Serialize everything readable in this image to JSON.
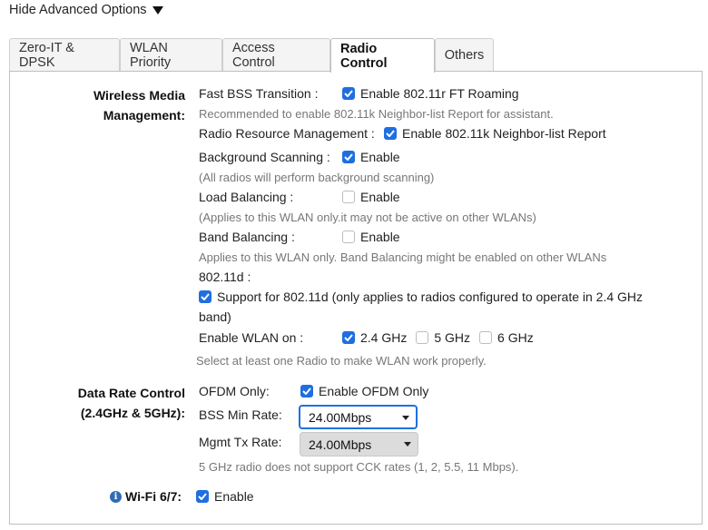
{
  "advanced_toggle": {
    "label": "Hide Advanced Options"
  },
  "tabs": [
    {
      "label": "Zero-IT & DPSK"
    },
    {
      "label": "WLAN Priority"
    },
    {
      "label": "Access Control"
    },
    {
      "label": "Radio Control",
      "active": true
    },
    {
      "label": "Others"
    }
  ],
  "wireless_media": {
    "label_line1": "Wireless Media",
    "label_line2": "Management:",
    "fast_bss": {
      "label": "Fast BSS Transition :",
      "checkbox_label": "Enable 802.11r FT Roaming",
      "checked": true,
      "hint": "Recommended to enable 802.11k Neighbor-list Report for assistant."
    },
    "rrm": {
      "label": "Radio Resource Management :",
      "checkbox_label": "Enable 802.11k Neighbor-list Report",
      "checked": true
    },
    "bg_scan": {
      "label": "Background Scanning :",
      "checkbox_label": "Enable",
      "checked": true,
      "hint": "(All radios will perform background scanning)"
    },
    "load_balancing": {
      "label": "Load Balancing :",
      "checkbox_label": "Enable",
      "checked": false,
      "hint": "(Applies to this WLAN only.it may not be active on other WLANs)"
    },
    "band_balancing": {
      "label": "Band Balancing :",
      "checkbox_label": "Enable",
      "checked": false,
      "hint": "Applies to this WLAN only. Band Balancing might be enabled on other WLANs"
    },
    "dot11d": {
      "label": "802.11d :",
      "checkbox_label_line1": "Support for 802.11d (only applies to radios configured to operate in 2.4 GHz",
      "checkbox_label_line2": "band)",
      "checked": true
    },
    "enable_wlan_on": {
      "label": "Enable WLAN on :",
      "options": [
        {
          "label": "2.4 GHz",
          "checked": true
        },
        {
          "label": "5 GHz",
          "checked": false
        },
        {
          "label": "6 GHz",
          "checked": false
        }
      ],
      "hint": "Select at least one Radio to make WLAN work properly."
    }
  },
  "data_rate": {
    "label_line1": "Data Rate Control",
    "label_line2": "(2.4GHz & 5GHz):",
    "ofdm": {
      "label": "OFDM Only:",
      "checkbox_label": "Enable OFDM Only",
      "checked": true
    },
    "bss_min_rate": {
      "label": "BSS Min Rate:",
      "value": "24.00Mbps"
    },
    "mgmt_tx_rate": {
      "label": "Mgmt Tx Rate:",
      "value": "24.00Mbps"
    },
    "hint": "5 GHz radio does not support CCK rates (1, 2, 5.5, 11 Mbps)."
  },
  "wifi67": {
    "info_icon": "i",
    "label": "Wi-Fi 6/7:",
    "checkbox_label": "Enable",
    "checked": true
  },
  "colors": {
    "accent": "#1f6fe0",
    "hint_text": "#777777",
    "info": "#2f6db5"
  }
}
